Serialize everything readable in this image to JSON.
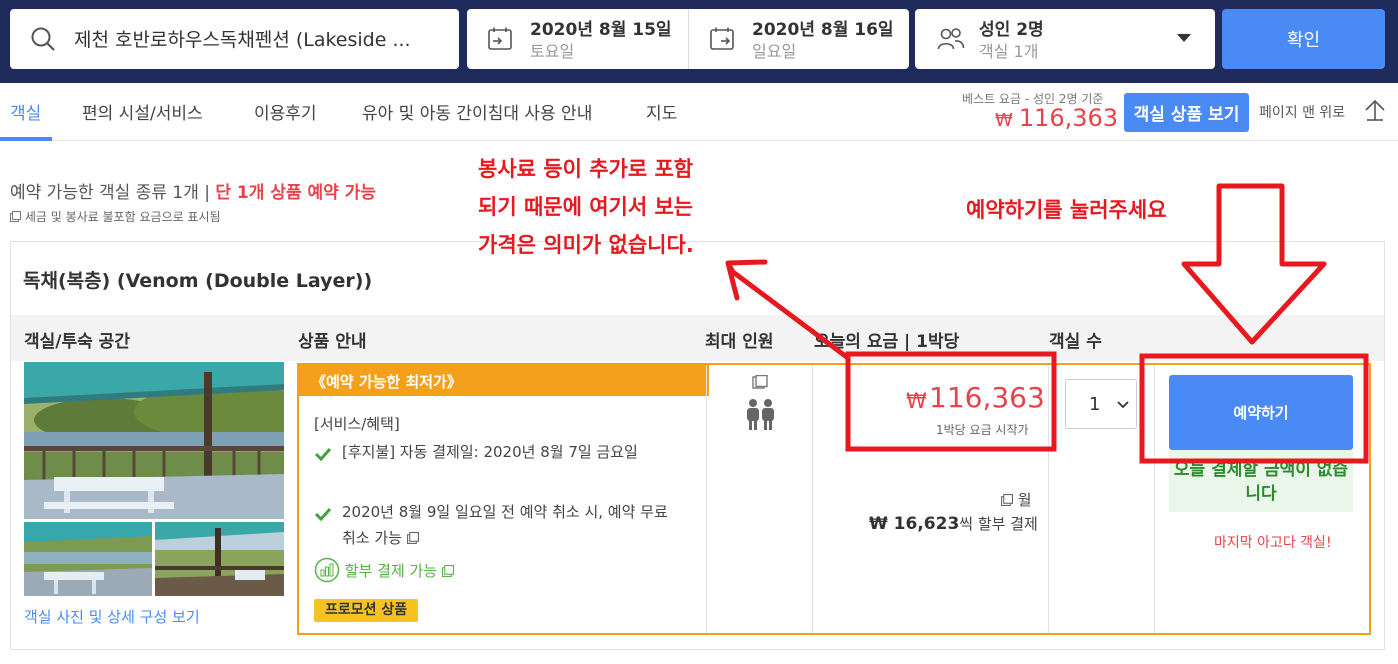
{
  "search": {
    "destination": "제천 호반로하우스독채펜션 (Lakeside ...",
    "checkin": {
      "date": "2020년 8월 15일",
      "weekday": "토요일"
    },
    "checkout": {
      "date": "2020년 8월 16일",
      "weekday": "일요일"
    },
    "guests": {
      "adults": "성인 2명",
      "rooms": "객실 1개"
    },
    "confirm_label": "확인"
  },
  "nav": {
    "tabs": [
      {
        "label": "객실",
        "active": true
      },
      {
        "label": "편의 시설/서비스"
      },
      {
        "label": "이용후기"
      },
      {
        "label": "유아 및 아동 간이침대 사용 안내"
      },
      {
        "label": "지도"
      }
    ],
    "best_label": "베스트 요금 - 성인 2명 기준",
    "best_price_symbol": "₩",
    "best_price": "116,363",
    "view_rooms_label": "객실 상품 보기",
    "to_top_label": "페이지 맨 위로"
  },
  "availability": {
    "text": "예약 가능한 객실 종류 1개 | ",
    "highlight": "단 1개 상품 예약 가능",
    "tax_note": "세금 및 봉사료 불포함 요금으로 표시됨"
  },
  "room": {
    "title": "독채(복층) (Venom (Double Layer))",
    "columns": [
      "객실/투숙 공간",
      "상품 안내",
      "최대 인원",
      "오늘의 요금 | 1박당",
      "객실 수"
    ],
    "photo_link": "객실 사진 및 상세 구성 보기",
    "offer": {
      "badge": "《예약 가능한 최저가》",
      "services_title": "[서비스/혜택]",
      "services": [
        "[후지불] 자동 결제일: 2020년 8월 7일 금요일",
        "2020년 8월 9일 일요일 전 예약 취소 시, 예약 무료 취소 가능"
      ],
      "installment_link": "할부 결제 가능",
      "promo_tag": "프로모션 상품",
      "price_symbol": "₩",
      "price": "116,363",
      "price_sub": "1박당 요금 시작가",
      "monthly_a": "월",
      "monthly_amount": "₩ 16,623",
      "monthly_suffix": "씩 할부 결제",
      "quantity": "1",
      "reserve_label": "예약하기",
      "no_payment_text": "오늘 결제할 금액이 없습니다",
      "last_room": "마지막 아고다 객실!"
    }
  },
  "annotations": {
    "note_a": [
      "봉사료 등이 추가로 포함",
      "되기 때문에 여기서 보는",
      "가격은 의미가 없습니다."
    ],
    "note_b": "예약하기를 눌러주세요"
  },
  "colors": {
    "navy": "#1f2b5a",
    "accent_blue": "#4a8af4",
    "price_red": "#e8434b",
    "offer_orange": "#f5a01b",
    "promo_yellow": "#f7c322",
    "annotation_red": "#e8181f"
  }
}
